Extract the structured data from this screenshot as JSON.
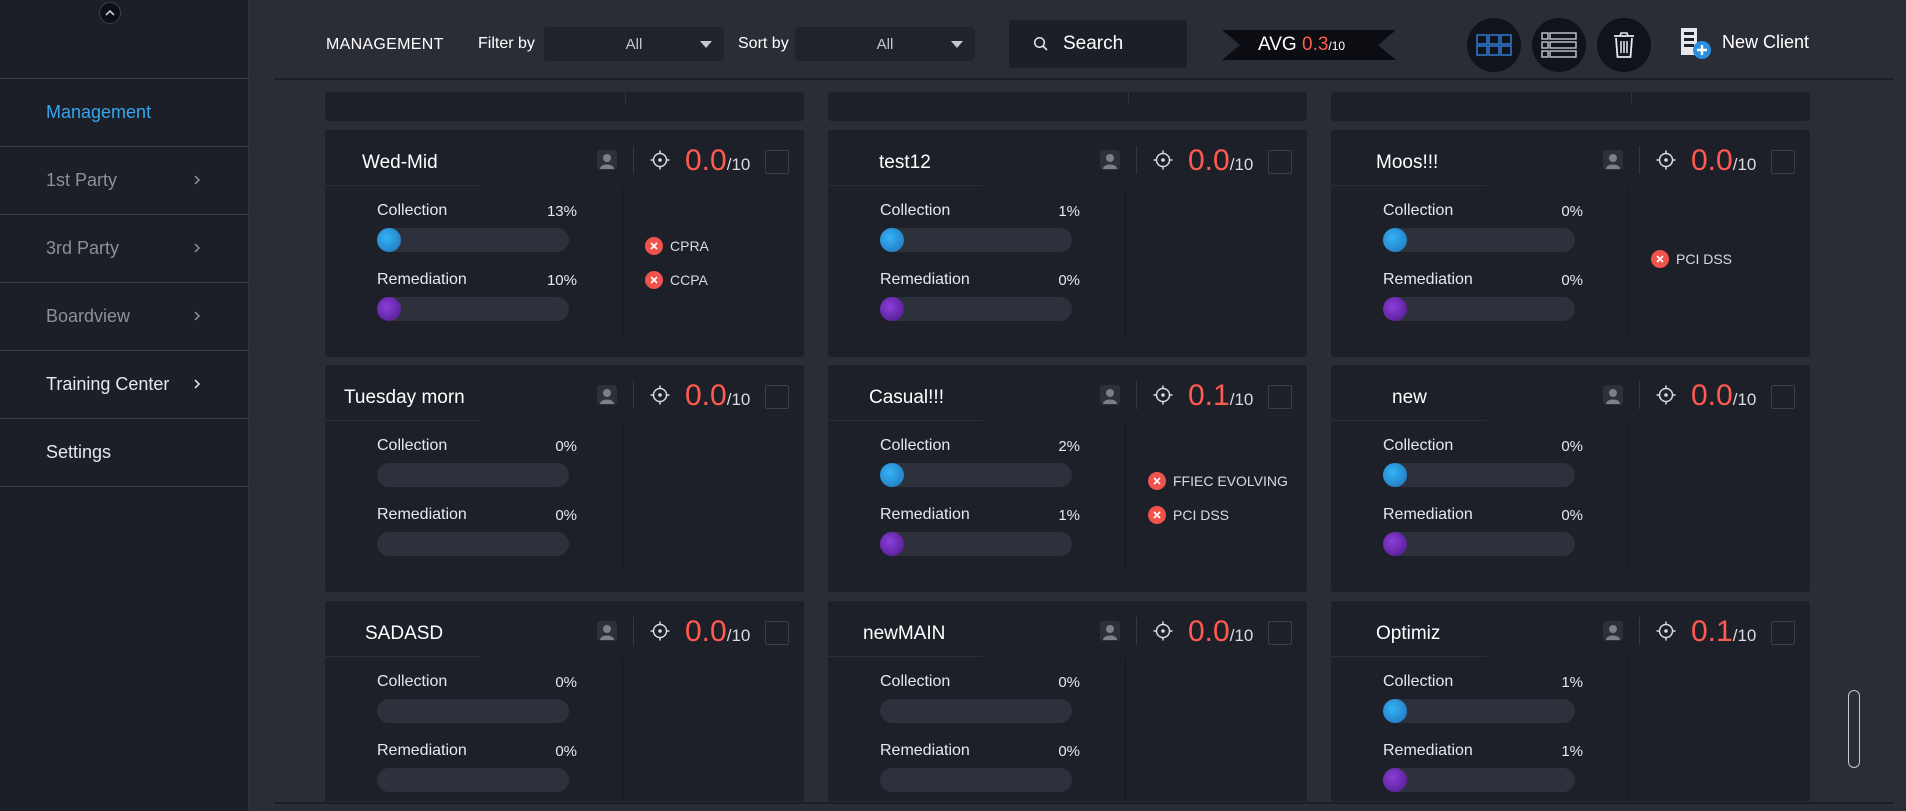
{
  "sidebar": {
    "items": [
      {
        "label": "Management",
        "state": "active",
        "has_chevron": false
      },
      {
        "label": "1st Party",
        "state": "muted",
        "has_chevron": true
      },
      {
        "label": "3rd Party",
        "state": "muted",
        "has_chevron": true
      },
      {
        "label": "Boardview",
        "state": "muted",
        "has_chevron": true
      },
      {
        "label": "Training Center",
        "state": "normal",
        "has_chevron": true
      },
      {
        "label": "Settings",
        "state": "normal",
        "has_chevron": false
      }
    ]
  },
  "toolbar": {
    "title": "MANAGEMENT",
    "filter_label": "Filter by",
    "filter_value": "All",
    "sort_label": "Sort by",
    "sort_value": "All",
    "search_label": "Search",
    "avg_label": "AVG",
    "avg_value": "0.3",
    "avg_denominator": "/10",
    "new_client_label": "New Client"
  },
  "colors": {
    "accent": "#35a6ee",
    "score": "#ff5a4f",
    "collection": "#35b3f5",
    "remediation": "#8b3fd9",
    "tag_error": "#f0524c"
  },
  "clients": [
    {
      "name": "Wed-Mid",
      "score": "0.0",
      "denominator": "/10",
      "collection_label": "Collection",
      "collection": "13%",
      "remediation_label": "Remediation",
      "remediation": "10%",
      "show_collection_dot": true,
      "show_remediation_dot": true,
      "tags": [
        "CPRA",
        "CCPA"
      ]
    },
    {
      "name": "test12",
      "score": "0.0",
      "denominator": "/10",
      "collection_label": "Collection",
      "collection": "1%",
      "remediation_label": "Remediation",
      "remediation": "0%",
      "show_collection_dot": true,
      "show_remediation_dot": true,
      "tags": []
    },
    {
      "name": "Moos!!!",
      "score": "0.0",
      "denominator": "/10",
      "collection_label": "Collection",
      "collection": "0%",
      "remediation_label": "Remediation",
      "remediation": "0%",
      "show_collection_dot": true,
      "show_remediation_dot": true,
      "tags": [
        "PCI DSS"
      ]
    },
    {
      "name": "Tuesday morn",
      "score": "0.0",
      "denominator": "/10",
      "collection_label": "Collection",
      "collection": "0%",
      "remediation_label": "Remediation",
      "remediation": "0%",
      "show_collection_dot": false,
      "show_remediation_dot": false,
      "tags": []
    },
    {
      "name": "Casual!!!",
      "score": "0.1",
      "denominator": "/10",
      "collection_label": "Collection",
      "collection": "2%",
      "remediation_label": "Remediation",
      "remediation": "1%",
      "show_collection_dot": true,
      "show_remediation_dot": true,
      "tags": [
        "FFIEC EVOLVING",
        "PCI DSS"
      ]
    },
    {
      "name": "new",
      "score": "0.0",
      "denominator": "/10",
      "collection_label": "Collection",
      "collection": "0%",
      "remediation_label": "Remediation",
      "remediation": "0%",
      "show_collection_dot": true,
      "show_remediation_dot": true,
      "tags": []
    },
    {
      "name": "SADASD",
      "score": "0.0",
      "denominator": "/10",
      "collection_label": "Collection",
      "collection": "0%",
      "remediation_label": "Remediation",
      "remediation": "0%",
      "show_collection_dot": false,
      "show_remediation_dot": false,
      "tags": []
    },
    {
      "name": "newMAIN",
      "score": "0.0",
      "denominator": "/10",
      "collection_label": "Collection",
      "collection": "0%",
      "remediation_label": "Remediation",
      "remediation": "0%",
      "show_collection_dot": false,
      "show_remediation_dot": false,
      "tags": []
    },
    {
      "name": "Optimiz",
      "score": "0.1",
      "denominator": "/10",
      "collection_label": "Collection",
      "collection": "1%",
      "remediation_label": "Remediation",
      "remediation": "1%",
      "show_collection_dot": true,
      "show_remediation_dot": true,
      "tags": []
    }
  ]
}
